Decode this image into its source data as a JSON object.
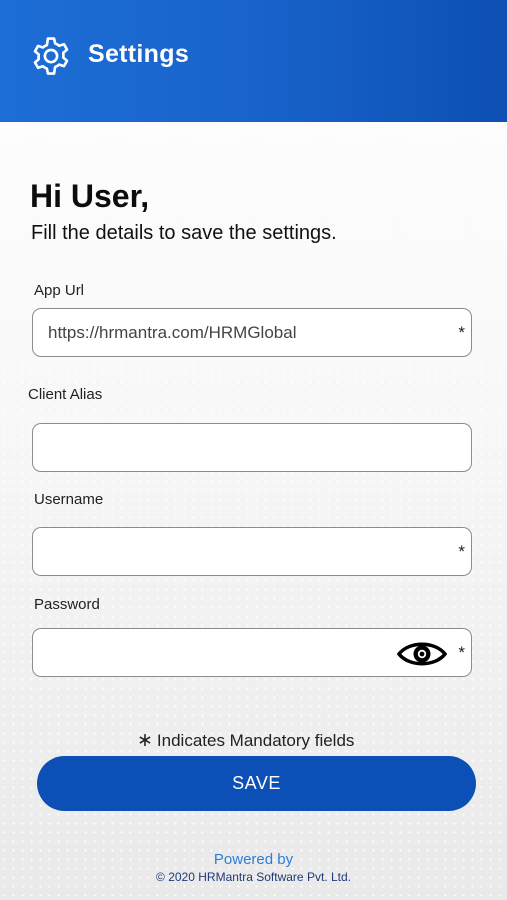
{
  "header": {
    "icon": "gear-icon",
    "title": "Settings",
    "gradient": [
      "#1d6ed6",
      "#0d4fb3"
    ]
  },
  "greeting": "Hi User,",
  "subtitle": "Fill the details to save the settings.",
  "fields": {
    "app_url": {
      "label": "App Url",
      "value": "https://hrmantra.com/HRMGlobal",
      "required_marker": "*"
    },
    "client_alias": {
      "label": "Client Alias",
      "value": ""
    },
    "username": {
      "label": "Username",
      "value": "",
      "required_marker": "*"
    },
    "password": {
      "label": "Password",
      "value": "",
      "required_marker": "*",
      "toggle_icon": "eye-icon"
    }
  },
  "mandatory_note": {
    "marker": "∗",
    "text": "Indicates Mandatory fields"
  },
  "save_button": {
    "label": "SAVE",
    "color": "#0c4fb6"
  },
  "footer": {
    "powered_by": "Powered by",
    "copyright": "© 2020 HRMantra Software Pvt. Ltd."
  }
}
